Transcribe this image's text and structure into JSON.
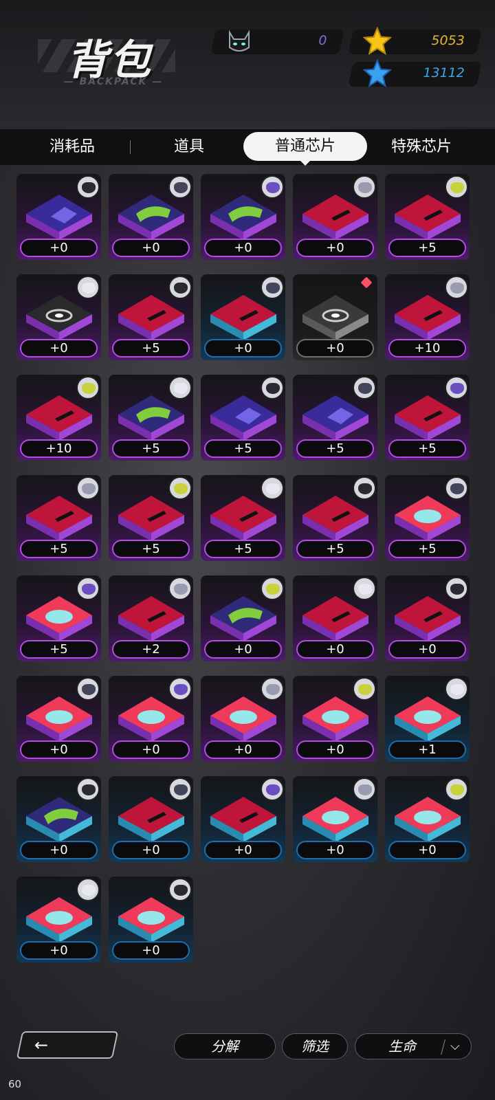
{
  "header": {
    "title": "背包",
    "subtitle": "— BACKPACK —",
    "currencies": [
      {
        "name": "cat-token",
        "value": "0",
        "color": "#8a6cd8"
      },
      {
        "name": "gold-star",
        "value": "5053",
        "color": "#e8b532"
      },
      {
        "name": "blue-star",
        "value": "13112",
        "color": "#3aa7e8"
      }
    ]
  },
  "tabs": [
    {
      "label": "消耗品",
      "active": false
    },
    {
      "label": "道具",
      "active": false
    },
    {
      "label": "普通芯片",
      "active": true
    },
    {
      "label": "特殊芯片",
      "active": false
    }
  ],
  "chips": [
    {
      "art": "emblem",
      "frame": "purple",
      "level": "+0"
    },
    {
      "art": "green",
      "frame": "purple",
      "level": "+0"
    },
    {
      "art": "green",
      "frame": "purple",
      "level": "+0"
    },
    {
      "art": "red",
      "frame": "purple",
      "level": "+0"
    },
    {
      "art": "red",
      "frame": "purple",
      "level": "+5"
    },
    {
      "art": "vortex",
      "frame": "purple",
      "level": "+0"
    },
    {
      "art": "red",
      "frame": "purple",
      "level": "+5"
    },
    {
      "art": "red",
      "frame": "cyan",
      "level": "+0"
    },
    {
      "art": "vortex",
      "frame": "gray",
      "level": "+0",
      "new": true
    },
    {
      "art": "red",
      "frame": "purple",
      "level": "+10"
    },
    {
      "art": "red",
      "frame": "purple",
      "level": "+10"
    },
    {
      "art": "green",
      "frame": "purple",
      "level": "+5"
    },
    {
      "art": "emblem",
      "frame": "purple",
      "level": "+5"
    },
    {
      "art": "emblem",
      "frame": "purple",
      "level": "+5"
    },
    {
      "art": "red",
      "frame": "purple",
      "level": "+5"
    },
    {
      "art": "red",
      "frame": "purple",
      "level": "+5"
    },
    {
      "art": "red",
      "frame": "purple",
      "level": "+5"
    },
    {
      "art": "red",
      "frame": "purple",
      "level": "+5"
    },
    {
      "art": "red",
      "frame": "purple",
      "level": "+5"
    },
    {
      "art": "brain",
      "frame": "purple",
      "level": "+5"
    },
    {
      "art": "brain",
      "frame": "purple",
      "level": "+5"
    },
    {
      "art": "red",
      "frame": "purple",
      "level": "+2"
    },
    {
      "art": "green",
      "frame": "purple",
      "level": "+0"
    },
    {
      "art": "red",
      "frame": "purple",
      "level": "+0"
    },
    {
      "art": "red",
      "frame": "purple",
      "level": "+0"
    },
    {
      "art": "brain",
      "frame": "purple",
      "level": "+0"
    },
    {
      "art": "brain",
      "frame": "purple",
      "level": "+0"
    },
    {
      "art": "brain",
      "frame": "purple",
      "level": "+0"
    },
    {
      "art": "brain",
      "frame": "purple",
      "level": "+0"
    },
    {
      "art": "brain",
      "frame": "cyan",
      "level": "+1"
    },
    {
      "art": "green",
      "frame": "cyan",
      "level": "+0"
    },
    {
      "art": "red",
      "frame": "cyan",
      "level": "+0"
    },
    {
      "art": "red",
      "frame": "cyan",
      "level": "+0"
    },
    {
      "art": "brain",
      "frame": "cyan",
      "level": "+0"
    },
    {
      "art": "brain",
      "frame": "cyan",
      "level": "+0"
    },
    {
      "art": "brain",
      "frame": "cyan",
      "level": "+0"
    },
    {
      "art": "brain",
      "frame": "cyan",
      "level": "+0"
    }
  ],
  "bottom": {
    "back_icon": "arrow-left-icon",
    "decompose": "分解",
    "filter": "筛选",
    "sort": "生命",
    "sort_chevron": "chevron-down-icon"
  },
  "fps": "60"
}
